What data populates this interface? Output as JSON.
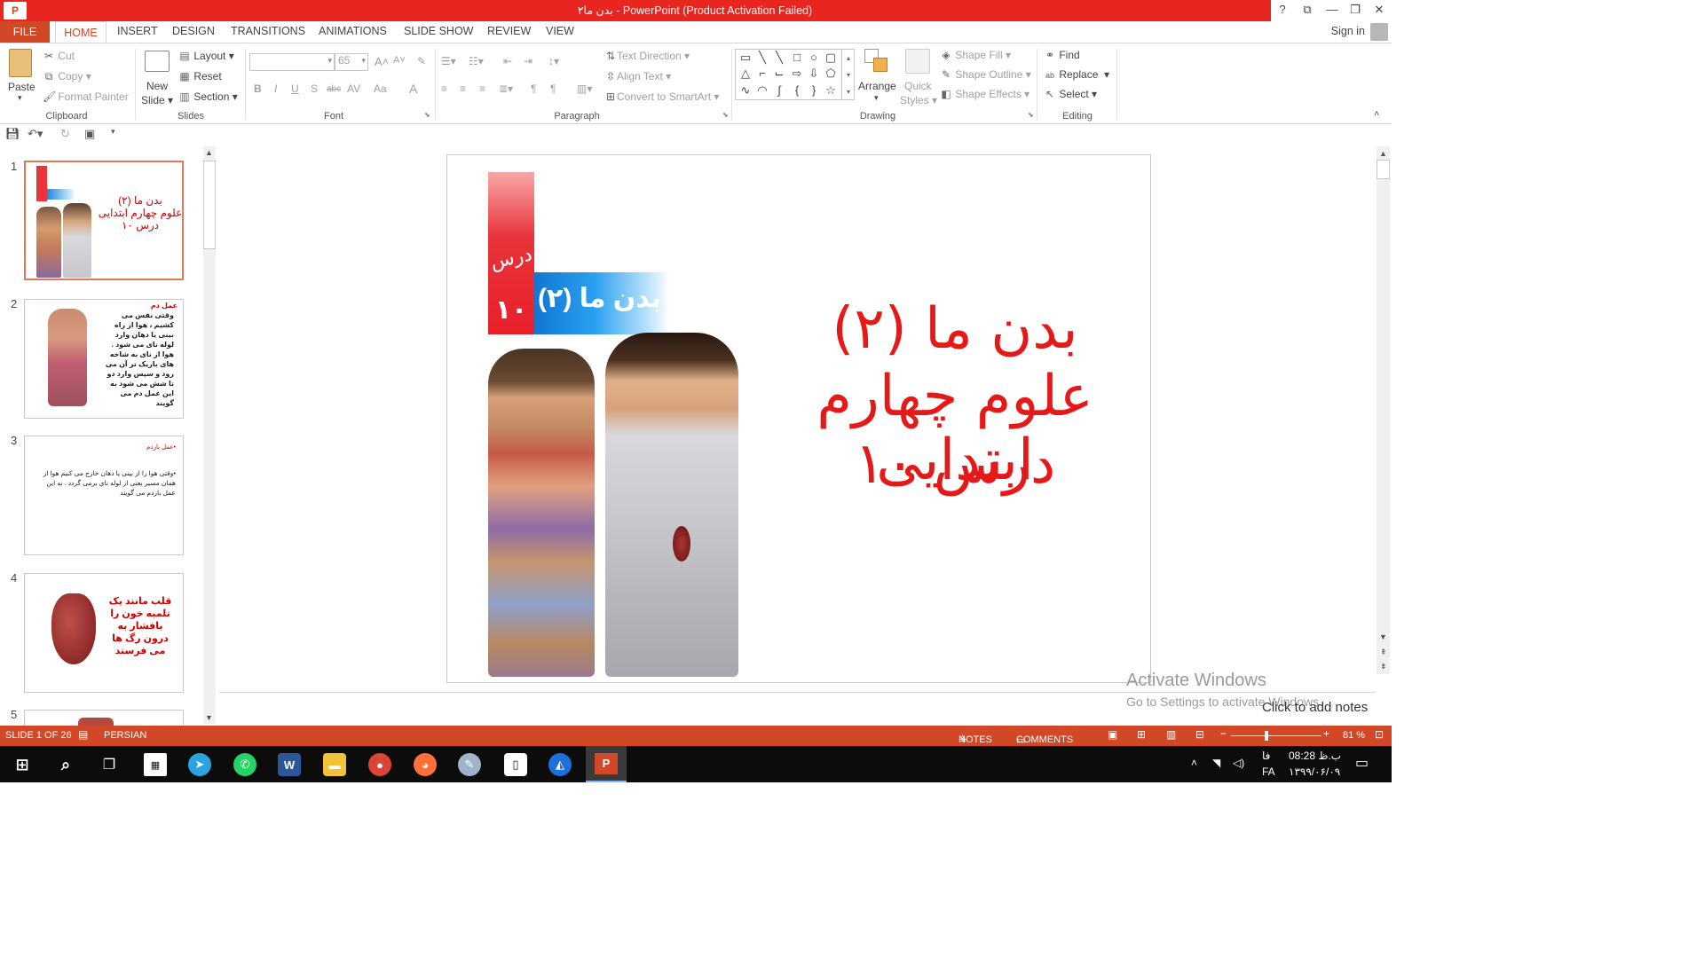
{
  "window": {
    "title": "بدن ما۲ - PowerPoint (Product Activation Failed)",
    "app_badge": "P",
    "controls": {
      "help": "?",
      "ribbon_options": "⧉",
      "minimize": "—",
      "restore": "❐",
      "close": "✕"
    }
  },
  "tabs": {
    "file": "FILE",
    "items": [
      "HOME",
      "INSERT",
      "DESIGN",
      "TRANSITIONS",
      "ANIMATIONS",
      "SLIDE SHOW",
      "REVIEW",
      "VIEW"
    ],
    "active": "HOME",
    "signin": "Sign in"
  },
  "ribbon": {
    "clipboard": {
      "label": "Clipboard",
      "paste": "Paste",
      "cut": "Cut",
      "copy": "Copy",
      "format_painter": "Format Painter"
    },
    "slides": {
      "label": "Slides",
      "new_slide_line1": "New",
      "new_slide_line2": "Slide",
      "layout": "Layout",
      "reset": "Reset",
      "section": "Section"
    },
    "font": {
      "label": "Font",
      "font_name": "",
      "font_size": "65",
      "bold": "B",
      "italic": "I",
      "underline": "U",
      "shadow": "S",
      "strike": "abc",
      "spacing": "AV",
      "case": "Aa",
      "color": "A"
    },
    "paragraph": {
      "label": "Paragraph",
      "text_direction": "Text Direction",
      "align_text": "Align Text",
      "convert_smartart": "Convert to SmartArt"
    },
    "drawing": {
      "label": "Drawing",
      "arrange": "Arrange",
      "quick_styles_line1": "Quick",
      "quick_styles_line2": "Styles",
      "shape_fill": "Shape Fill",
      "shape_outline": "Shape Outline",
      "shape_effects": "Shape Effects"
    },
    "editing": {
      "label": "Editing",
      "find": "Find",
      "replace": "Replace",
      "select": "Select"
    }
  },
  "thumbnails": [
    {
      "num": "1",
      "text": "بدن ما (۲)\nعلوم چهارم ابتدایی\nدرس ۱۰",
      "selected": true
    },
    {
      "num": "2",
      "heading": "عمل دم",
      "text": "وقتی نفس می کشیم ، هوا از راه بینی یا دهان وارد لوله نای می شود . هوا از نای به شاخه های باریک تر آن می رود و سپس وارد دو تا شش می شود به این عمل دم می گویند"
    },
    {
      "num": "3",
      "heading": "•عمل بازدم",
      "text": "•وقتی هوا را از بینی یا دهان خارج می کنیم هوا از همان مسیر یعنی از لوله نای  برمی گردد . به این عمل بازدم می گویند"
    },
    {
      "num": "4",
      "text": "قلب مانند یک تلمبه خون را بافشار به درون رگ ها می فرستد"
    },
    {
      "num": "5"
    }
  ],
  "slide": {
    "title_line1": "بدن ما (۲)",
    "title_line2": "علوم چهارم ابتدایی",
    "title_line3": "درس ۱۰",
    "badge_lesson": "درس",
    "badge_number": "۱۰",
    "badge_title": "بدن ما (۲)"
  },
  "notes": {
    "placeholder": "Click to add notes"
  },
  "watermark": {
    "line1": "Activate Windows",
    "line2": "Go to Settings to activate Windows."
  },
  "status": {
    "slide_info": "SLIDE 1 OF 26",
    "language": "PERSIAN",
    "notes": "NOTES",
    "comments": "COMMENTS",
    "zoom": "81 %"
  },
  "taskbar": {
    "time": "08:28 ب.ظ",
    "date": "۱۳۹۹/۰۶/۰۹",
    "lang": "FA",
    "lang_alt": "فا"
  },
  "colors": {
    "accent": "#d24726",
    "title_red": "#e8251e",
    "slide_text": "#e61919"
  }
}
